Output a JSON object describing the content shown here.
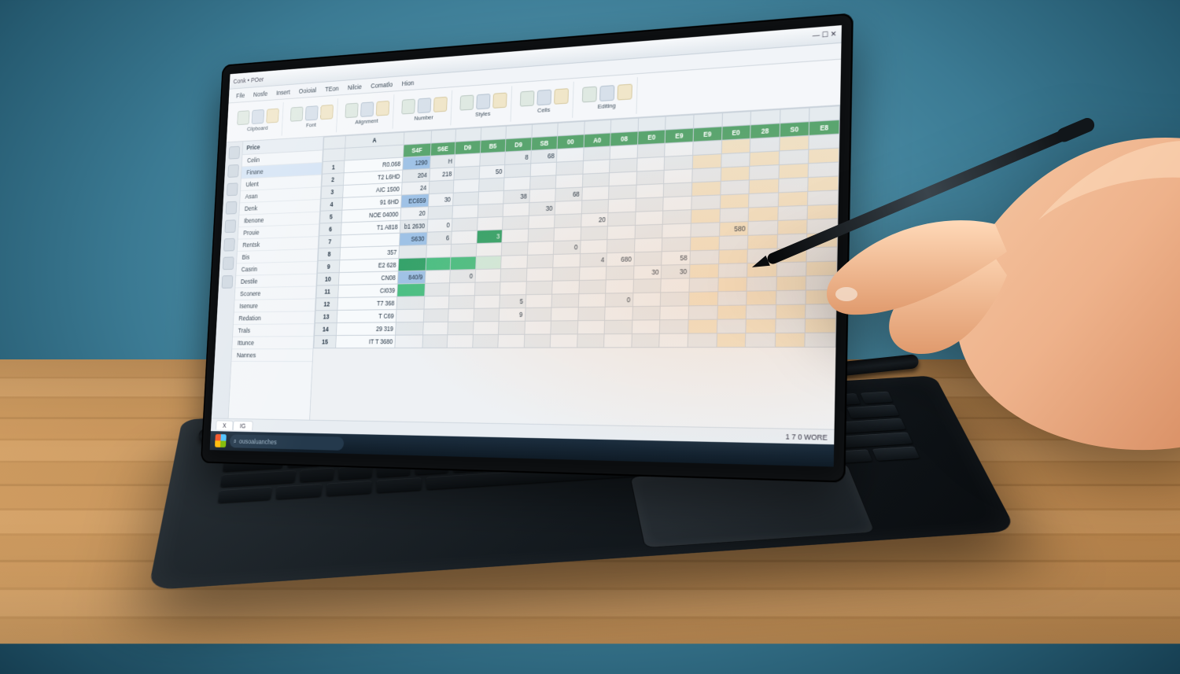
{
  "titlebar": {
    "left": "Conk  •  POer",
    "right": "—  ☐  ✕"
  },
  "menu": [
    "File",
    "Nosfe",
    "Insert",
    "Ooioial",
    "TEon",
    "Nilcie",
    "Comatlo",
    "Hion"
  ],
  "ribbon_labels": [
    "Clipboard",
    "Font",
    "Alignment",
    "Number",
    "Styles",
    "Cells",
    "Editing"
  ],
  "side_header": "Price",
  "side_items": [
    {
      "t": "Celin",
      "sel": false
    },
    {
      "t": "Finane",
      "sel": true
    },
    {
      "t": "Ulent",
      "sel": false
    },
    {
      "t": "Asan",
      "sel": false
    },
    {
      "t": "Denk",
      "sel": false
    },
    {
      "t": "Ibenone",
      "sel": false
    },
    {
      "t": "Prouie",
      "sel": false
    },
    {
      "t": "Rentsk",
      "sel": false
    },
    {
      "t": "Bis",
      "sel": false
    },
    {
      "t": "Casrin",
      "sel": false
    },
    {
      "t": "Destile",
      "sel": false
    },
    {
      "t": "Sconere",
      "sel": false
    },
    {
      "t": "Isenure",
      "sel": false
    },
    {
      "t": "Redation",
      "sel": false
    },
    {
      "t": "Trals",
      "sel": false
    },
    {
      "t": "Ittunce",
      "sel": false
    },
    {
      "t": "Nannes",
      "sel": false
    }
  ],
  "col_headers": [
    "S4F",
    "S6E",
    "D9",
    "B5",
    "D9",
    "SB",
    "00",
    "A0",
    "08",
    "E0",
    "E9",
    "E9",
    "E0",
    "28",
    "S0",
    "E8"
  ],
  "rows": [
    {
      "label": "R0.068",
      "v": [
        "1290",
        "H",
        "",
        "",
        "8",
        "68",
        "",
        "",
        "",
        "",
        "",
        "",
        "",
        "",
        "",
        ""
      ],
      "cls": [
        "blue",
        "",
        "",
        "",
        "grey",
        "",
        "",
        "",
        "",
        "",
        "",
        "",
        "",
        "",
        "",
        ""
      ]
    },
    {
      "label": "T2 L6HD",
      "v": [
        "204",
        "218",
        "",
        "50",
        "",
        "",
        "",
        "",
        "",
        "",
        "",
        "",
        "",
        "",
        "",
        ""
      ],
      "cls": [
        "",
        "",
        "",
        "",
        "",
        "",
        "",
        "",
        "",
        "",
        "",
        "",
        "",
        "",
        "",
        ""
      ]
    },
    {
      "label": "AIC 1500",
      "v": [
        "24",
        "",
        "",
        "",
        "",
        "",
        "",
        "",
        "",
        "",
        "",
        "",
        "",
        "",
        "",
        ""
      ],
      "cls": [
        "",
        "",
        "",
        "",
        "",
        "",
        "",
        "",
        "",
        "",
        "",
        "",
        "",
        "",
        "",
        ""
      ]
    },
    {
      "label": "91 6HD",
      "v": [
        "EC659",
        "30",
        "",
        "",
        "38",
        "",
        "68",
        "",
        "",
        "",
        "",
        "",
        "",
        "",
        "",
        ""
      ],
      "cls": [
        "blue",
        "",
        "",
        "",
        "",
        "",
        "",
        "",
        "",
        "",
        "",
        "",
        "",
        "",
        "",
        ""
      ]
    },
    {
      "label": "NOE 04000",
      "v": [
        "20",
        "",
        "",
        "",
        "",
        "30",
        "",
        "",
        "",
        "",
        "",
        "",
        "",
        "",
        "",
        ""
      ],
      "cls": [
        "",
        "",
        "",
        "",
        "",
        "",
        "",
        "",
        "",
        "",
        "",
        "",
        "",
        "",
        "",
        ""
      ]
    },
    {
      "label": "T1 A818",
      "v": [
        "b1 2630",
        "0",
        "",
        "",
        "",
        "",
        "",
        "20",
        "",
        "",
        "",
        "",
        "",
        "",
        "",
        ""
      ],
      "cls": [
        "",
        "",
        "",
        "",
        "",
        "",
        "",
        "",
        "",
        "",
        "",
        "",
        "",
        "",
        "",
        ""
      ]
    },
    {
      "label": "",
      "v": [
        "S630",
        "6",
        "",
        "3",
        "",
        "",
        "",
        "",
        "",
        "",
        "",
        "",
        "580",
        "",
        "",
        ""
      ],
      "cls": [
        "blue",
        "",
        "",
        "green",
        "",
        "",
        "",
        "",
        "",
        "",
        "",
        "",
        "",
        "",
        "",
        ""
      ]
    },
    {
      "label": "357",
      "v": [
        "",
        "",
        "",
        "",
        "",
        "",
        "0",
        "",
        "",
        "",
        "",
        "",
        "",
        "",
        "",
        ""
      ],
      "cls": [
        "",
        "",
        "",
        "",
        "",
        "",
        "",
        "",
        "",
        "",
        "",
        "",
        "",
        "",
        "",
        ""
      ]
    },
    {
      "label": "E2 628",
      "v": [
        "",
        "",
        "",
        "",
        "",
        "",
        "",
        "4",
        "680",
        "",
        "58",
        "",
        "",
        "",
        "",
        ""
      ],
      "cls": [
        "green",
        "green2",
        "green2",
        "lgreen",
        "",
        "",
        "",
        "",
        "",
        "",
        "",
        "",
        "",
        "",
        "",
        ""
      ]
    },
    {
      "label": "CN08",
      "v": [
        "840/9",
        "",
        "0",
        "",
        "",
        "",
        "",
        "",
        "",
        "30",
        "30",
        "",
        "",
        "",
        "",
        ""
      ],
      "cls": [
        "blue",
        "",
        "",
        "",
        "",
        "",
        "",
        "",
        "",
        "",
        "",
        "",
        "",
        "",
        "",
        ""
      ]
    },
    {
      "label": "CI039",
      "v": [
        "",
        "",
        "",
        "",
        "",
        "",
        "",
        "",
        "",
        "",
        "",
        "",
        "",
        "",
        "",
        ""
      ],
      "cls": [
        "green2",
        "",
        "",
        "",
        "",
        "",
        "",
        "",
        "",
        "",
        "",
        "",
        "",
        "",
        "",
        ""
      ]
    },
    {
      "label": "T7 368",
      "v": [
        "",
        "",
        "",
        "",
        "5",
        "",
        "",
        "",
        "0",
        "",
        "",
        "",
        "",
        "",
        "",
        ""
      ],
      "cls": [
        "",
        "",
        "",
        "",
        "",
        "",
        "",
        "",
        "",
        "",
        "",
        "",
        "",
        "",
        "",
        ""
      ]
    },
    {
      "label": "T C69",
      "v": [
        "",
        "",
        "",
        "",
        "9",
        "",
        "",
        "",
        "",
        "",
        "",
        "",
        "",
        "",
        "",
        ""
      ],
      "cls": [
        "",
        "",
        "",
        "",
        "",
        "",
        "",
        "",
        "",
        "",
        "",
        "",
        "",
        "",
        "",
        ""
      ]
    },
    {
      "label": "29 319",
      "v": [
        "",
        "",
        "",
        "",
        "",
        "",
        "",
        "",
        "",
        "",
        "",
        "",
        "",
        "",
        "",
        ""
      ],
      "cls": [
        "",
        "",
        "",
        "",
        "",
        "",
        "",
        "",
        "",
        "",
        "",
        "",
        "",
        "",
        "",
        ""
      ]
    },
    {
      "label": "IT T 3680",
      "v": [
        "",
        "",
        "",
        "",
        "",
        "",
        "",
        "",
        "",
        "",
        "",
        "",
        "",
        "",
        "",
        ""
      ],
      "cls": [
        "",
        "",
        "",
        "",
        "",
        "",
        "",
        "",
        "",
        "",
        "",
        "",
        "",
        "",
        "",
        ""
      ]
    }
  ],
  "sheet_tabs": [
    "X",
    "IG"
  ],
  "status_right": "1  7  0   WORE",
  "task_search_placeholder": "ousoaluanches",
  "task_icons": [
    "#3478f6",
    "#e44d26",
    "#59b958",
    "#f2c94c",
    "#9b59b6",
    "#1abc9c",
    "#e67e22",
    "#3498db"
  ],
  "colors": {
    "accent_green": "#35a36b",
    "accent_blue": "#9fc2e6",
    "bezel": "#0b0d0f"
  }
}
